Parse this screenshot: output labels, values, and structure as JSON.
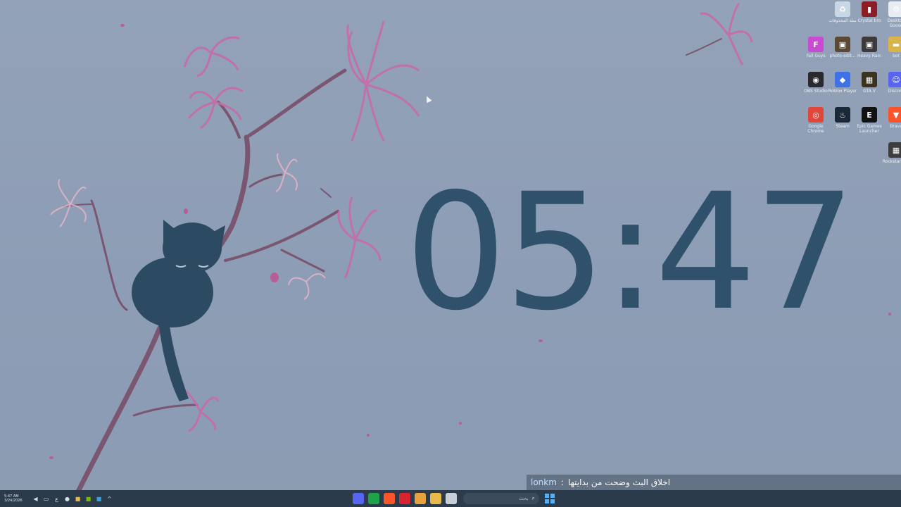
{
  "desktop": {
    "clock_text": "05:47",
    "icons": [
      {
        "name": "recycle-bin-icon",
        "label": "سلة المحذوفات",
        "color": "#c9d6e4",
        "glyph": "♻"
      },
      {
        "name": "crystal-icon",
        "label": "Crystal bro",
        "color": "#8b1d24",
        "glyph": "▮"
      },
      {
        "name": "settings-icon",
        "label": "Desktop Goose",
        "color": "#e8edf3",
        "glyph": "⚙"
      },
      {
        "name": "fall-guys-icon",
        "label": "Fall Guys",
        "color": "#c94bd1",
        "glyph": "F"
      },
      {
        "name": "photo-icon",
        "label": "photo-edit...",
        "color": "#5b4a33",
        "glyph": "▣"
      },
      {
        "name": "heavy-rain-icon",
        "label": "Heavy Rain",
        "color": "#3c3a3a",
        "glyph": "▣"
      },
      {
        "name": "folder-icon",
        "label": "bot",
        "color": "#d9b44a",
        "glyph": "▬"
      },
      {
        "name": "obs-icon",
        "label": "OBS Studio",
        "color": "#2a2a2e",
        "glyph": "◉"
      },
      {
        "name": "roblox-player-icon",
        "label": "Roblox Player",
        "color": "#3f72e4",
        "glyph": "◆"
      },
      {
        "name": "game-icon",
        "label": "GTA V",
        "color": "#3a3320",
        "glyph": "▦"
      },
      {
        "name": "discord-icon",
        "label": "Discord",
        "color": "#5865f2",
        "glyph": "☺"
      },
      {
        "name": "google-chrome-icon",
        "label": "Google Chrome",
        "color": "#e0463a",
        "glyph": "◎"
      },
      {
        "name": "steam-icon",
        "label": "Steam",
        "color": "#1b2838",
        "glyph": "♨"
      },
      {
        "name": "epic-games-icon",
        "label": "Epic Games Launcher",
        "color": "#121212",
        "glyph": "E"
      },
      {
        "name": "brave-icon",
        "label": "Brave",
        "color": "#fb542b",
        "glyph": "▼"
      },
      {
        "name": "shortcut-icon",
        "label": "Rockstar G...",
        "color": "#3d3d3d",
        "glyph": "▦"
      }
    ]
  },
  "chat": {
    "username": "lonkm",
    "separator": ":",
    "message": "اخلاق البث وضحت من بدايتها"
  },
  "taskbar": {
    "time": "5:47 AM",
    "date": "3/24/2026",
    "lang": "ع",
    "search_placeholder": "بحث",
    "apps": [
      {
        "name": "discord-taskbar-icon",
        "color": "#5865f2"
      },
      {
        "name": "xbox-taskbar-icon",
        "color": "#1fa34a"
      },
      {
        "name": "brave-taskbar-icon",
        "color": "#fb542b"
      },
      {
        "name": "opera-taskbar-icon",
        "color": "#d8242f"
      },
      {
        "name": "chrome-taskbar-icon",
        "color": "#e6a23c"
      },
      {
        "name": "file-explorer-taskbar-icon",
        "color": "#e5b94a"
      },
      {
        "name": "task-view-taskbar-icon",
        "color": "#c7ced8"
      }
    ],
    "start_color": "#4fb2ff"
  }
}
